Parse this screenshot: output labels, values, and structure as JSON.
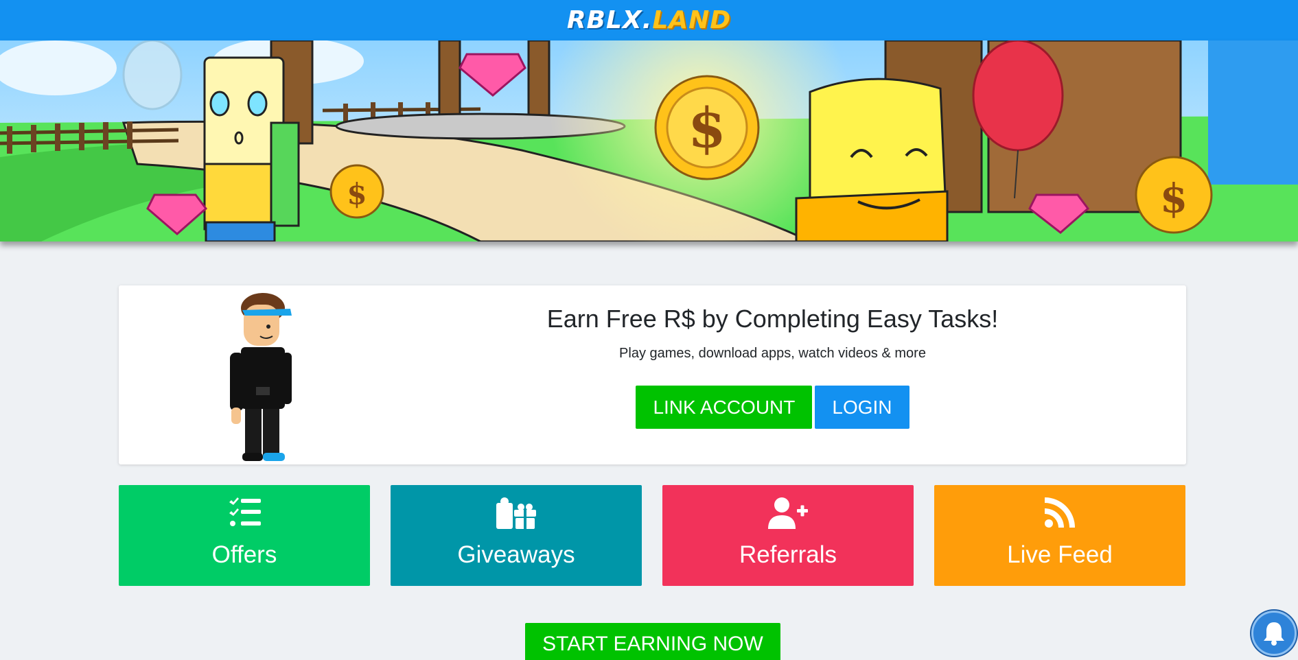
{
  "navbar": {
    "logo_part1": "RBLX.",
    "logo_part2": "LAND"
  },
  "hero": {
    "title": "Earn Free R$ by Completing Easy Tasks!",
    "subtitle": "Play games, download apps, watch videos & more",
    "link_account_label": "LINK ACCOUNT",
    "login_label": "LOGIN"
  },
  "tiles": [
    {
      "label": "Offers",
      "icon": "checklist-icon",
      "color": "#00cc66"
    },
    {
      "label": "Giveaways",
      "icon": "gift-icon",
      "color": "#0096a8"
    },
    {
      "label": "Referrals",
      "icon": "user-plus-icon",
      "color": "#f2325a"
    },
    {
      "label": "Live Feed",
      "icon": "rss-icon",
      "color": "#ff9d0a"
    }
  ],
  "start_button_label": "START EARNING NOW",
  "colors": {
    "navbar": "#1391f1",
    "green": "#00c200",
    "blue": "#1391f1",
    "background": "#eef1f4"
  }
}
